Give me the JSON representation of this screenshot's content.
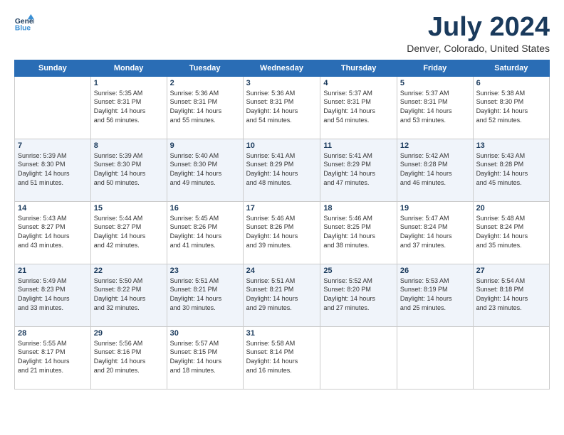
{
  "logo": {
    "line1": "General",
    "line2": "Blue"
  },
  "title": "July 2024",
  "location": "Denver, Colorado, United States",
  "header_days": [
    "Sunday",
    "Monday",
    "Tuesday",
    "Wednesday",
    "Thursday",
    "Friday",
    "Saturday"
  ],
  "weeks": [
    [
      {
        "num": "",
        "sunrise": "",
        "sunset": "",
        "daylight": ""
      },
      {
        "num": "1",
        "sunrise": "Sunrise: 5:35 AM",
        "sunset": "Sunset: 8:31 PM",
        "daylight": "Daylight: 14 hours and 56 minutes."
      },
      {
        "num": "2",
        "sunrise": "Sunrise: 5:36 AM",
        "sunset": "Sunset: 8:31 PM",
        "daylight": "Daylight: 14 hours and 55 minutes."
      },
      {
        "num": "3",
        "sunrise": "Sunrise: 5:36 AM",
        "sunset": "Sunset: 8:31 PM",
        "daylight": "Daylight: 14 hours and 54 minutes."
      },
      {
        "num": "4",
        "sunrise": "Sunrise: 5:37 AM",
        "sunset": "Sunset: 8:31 PM",
        "daylight": "Daylight: 14 hours and 54 minutes."
      },
      {
        "num": "5",
        "sunrise": "Sunrise: 5:37 AM",
        "sunset": "Sunset: 8:31 PM",
        "daylight": "Daylight: 14 hours and 53 minutes."
      },
      {
        "num": "6",
        "sunrise": "Sunrise: 5:38 AM",
        "sunset": "Sunset: 8:30 PM",
        "daylight": "Daylight: 14 hours and 52 minutes."
      }
    ],
    [
      {
        "num": "7",
        "sunrise": "Sunrise: 5:39 AM",
        "sunset": "Sunset: 8:30 PM",
        "daylight": "Daylight: 14 hours and 51 minutes."
      },
      {
        "num": "8",
        "sunrise": "Sunrise: 5:39 AM",
        "sunset": "Sunset: 8:30 PM",
        "daylight": "Daylight: 14 hours and 50 minutes."
      },
      {
        "num": "9",
        "sunrise": "Sunrise: 5:40 AM",
        "sunset": "Sunset: 8:30 PM",
        "daylight": "Daylight: 14 hours and 49 minutes."
      },
      {
        "num": "10",
        "sunrise": "Sunrise: 5:41 AM",
        "sunset": "Sunset: 8:29 PM",
        "daylight": "Daylight: 14 hours and 48 minutes."
      },
      {
        "num": "11",
        "sunrise": "Sunrise: 5:41 AM",
        "sunset": "Sunset: 8:29 PM",
        "daylight": "Daylight: 14 hours and 47 minutes."
      },
      {
        "num": "12",
        "sunrise": "Sunrise: 5:42 AM",
        "sunset": "Sunset: 8:28 PM",
        "daylight": "Daylight: 14 hours and 46 minutes."
      },
      {
        "num": "13",
        "sunrise": "Sunrise: 5:43 AM",
        "sunset": "Sunset: 8:28 PM",
        "daylight": "Daylight: 14 hours and 45 minutes."
      }
    ],
    [
      {
        "num": "14",
        "sunrise": "Sunrise: 5:43 AM",
        "sunset": "Sunset: 8:27 PM",
        "daylight": "Daylight: 14 hours and 43 minutes."
      },
      {
        "num": "15",
        "sunrise": "Sunrise: 5:44 AM",
        "sunset": "Sunset: 8:27 PM",
        "daylight": "Daylight: 14 hours and 42 minutes."
      },
      {
        "num": "16",
        "sunrise": "Sunrise: 5:45 AM",
        "sunset": "Sunset: 8:26 PM",
        "daylight": "Daylight: 14 hours and 41 minutes."
      },
      {
        "num": "17",
        "sunrise": "Sunrise: 5:46 AM",
        "sunset": "Sunset: 8:26 PM",
        "daylight": "Daylight: 14 hours and 39 minutes."
      },
      {
        "num": "18",
        "sunrise": "Sunrise: 5:46 AM",
        "sunset": "Sunset: 8:25 PM",
        "daylight": "Daylight: 14 hours and 38 minutes."
      },
      {
        "num": "19",
        "sunrise": "Sunrise: 5:47 AM",
        "sunset": "Sunset: 8:24 PM",
        "daylight": "Daylight: 14 hours and 37 minutes."
      },
      {
        "num": "20",
        "sunrise": "Sunrise: 5:48 AM",
        "sunset": "Sunset: 8:24 PM",
        "daylight": "Daylight: 14 hours and 35 minutes."
      }
    ],
    [
      {
        "num": "21",
        "sunrise": "Sunrise: 5:49 AM",
        "sunset": "Sunset: 8:23 PM",
        "daylight": "Daylight: 14 hours and 33 minutes."
      },
      {
        "num": "22",
        "sunrise": "Sunrise: 5:50 AM",
        "sunset": "Sunset: 8:22 PM",
        "daylight": "Daylight: 14 hours and 32 minutes."
      },
      {
        "num": "23",
        "sunrise": "Sunrise: 5:51 AM",
        "sunset": "Sunset: 8:21 PM",
        "daylight": "Daylight: 14 hours and 30 minutes."
      },
      {
        "num": "24",
        "sunrise": "Sunrise: 5:51 AM",
        "sunset": "Sunset: 8:21 PM",
        "daylight": "Daylight: 14 hours and 29 minutes."
      },
      {
        "num": "25",
        "sunrise": "Sunrise: 5:52 AM",
        "sunset": "Sunset: 8:20 PM",
        "daylight": "Daylight: 14 hours and 27 minutes."
      },
      {
        "num": "26",
        "sunrise": "Sunrise: 5:53 AM",
        "sunset": "Sunset: 8:19 PM",
        "daylight": "Daylight: 14 hours and 25 minutes."
      },
      {
        "num": "27",
        "sunrise": "Sunrise: 5:54 AM",
        "sunset": "Sunset: 8:18 PM",
        "daylight": "Daylight: 14 hours and 23 minutes."
      }
    ],
    [
      {
        "num": "28",
        "sunrise": "Sunrise: 5:55 AM",
        "sunset": "Sunset: 8:17 PM",
        "daylight": "Daylight: 14 hours and 21 minutes."
      },
      {
        "num": "29",
        "sunrise": "Sunrise: 5:56 AM",
        "sunset": "Sunset: 8:16 PM",
        "daylight": "Daylight: 14 hours and 20 minutes."
      },
      {
        "num": "30",
        "sunrise": "Sunrise: 5:57 AM",
        "sunset": "Sunset: 8:15 PM",
        "daylight": "Daylight: 14 hours and 18 minutes."
      },
      {
        "num": "31",
        "sunrise": "Sunrise: 5:58 AM",
        "sunset": "Sunset: 8:14 PM",
        "daylight": "Daylight: 14 hours and 16 minutes."
      },
      {
        "num": "",
        "sunrise": "",
        "sunset": "",
        "daylight": ""
      },
      {
        "num": "",
        "sunrise": "",
        "sunset": "",
        "daylight": ""
      },
      {
        "num": "",
        "sunrise": "",
        "sunset": "",
        "daylight": ""
      }
    ]
  ]
}
